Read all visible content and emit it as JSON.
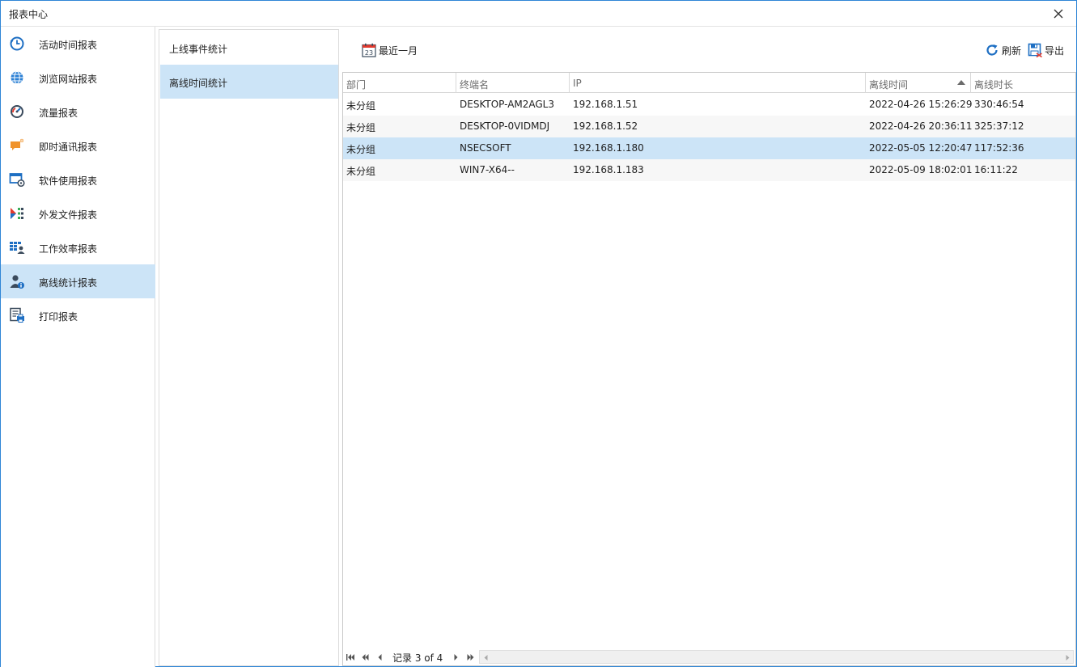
{
  "window": {
    "title": "报表中心"
  },
  "nav": {
    "items": [
      {
        "label": "活动时间报表",
        "icon": "clock-history-icon"
      },
      {
        "label": "浏览网站报表",
        "icon": "globe-icon"
      },
      {
        "label": "流量报表",
        "icon": "gauge-icon"
      },
      {
        "label": "即时通讯报表",
        "icon": "chat-icon"
      },
      {
        "label": "软件使用报表",
        "icon": "app-window-icon"
      },
      {
        "label": "外发文件报表",
        "icon": "file-share-icon"
      },
      {
        "label": "工作效率报表",
        "icon": "efficiency-grid-icon"
      },
      {
        "label": "离线统计报表",
        "icon": "user-info-icon"
      },
      {
        "label": "打印报表",
        "icon": "print-report-icon"
      }
    ],
    "active_index": 7
  },
  "subnav": {
    "items": [
      {
        "label": "上线事件统计"
      },
      {
        "label": "离线时间统计"
      }
    ],
    "active_index": 1
  },
  "toolbar": {
    "date_range_label": "最近一月",
    "date_icon_day": "23",
    "refresh_label": "刷新",
    "export_label": "导出"
  },
  "grid": {
    "columns": [
      "部门",
      "终端名",
      "IP",
      "离线时间",
      "离线时长"
    ],
    "sorted_column": "离线时间",
    "sort_direction": "ascending",
    "rows": [
      [
        "未分组",
        "DESKTOP-AM2AGL3",
        "192.168.1.51",
        "2022-04-26 15:26:29",
        "330:46:54"
      ],
      [
        "未分组",
        "DESKTOP-0VIDMDJ",
        "192.168.1.52",
        "2022-04-26 20:36:11",
        "325:37:12"
      ],
      [
        "未分组",
        "NSECSOFT",
        "192.168.1.180",
        "2022-05-05 12:20:47",
        "117:52:36"
      ],
      [
        "未分组",
        "WIN7-X64--",
        "192.168.1.183",
        "2022-05-09 18:02:01",
        "16:11:22"
      ]
    ],
    "selected_row": 2
  },
  "pager": {
    "record_text": "记录 3 of 4"
  },
  "colors": {
    "accent": "#2f86d6",
    "selection": "#cce4f7",
    "orange": "#f0932b",
    "blue": "#1e6fc3"
  }
}
